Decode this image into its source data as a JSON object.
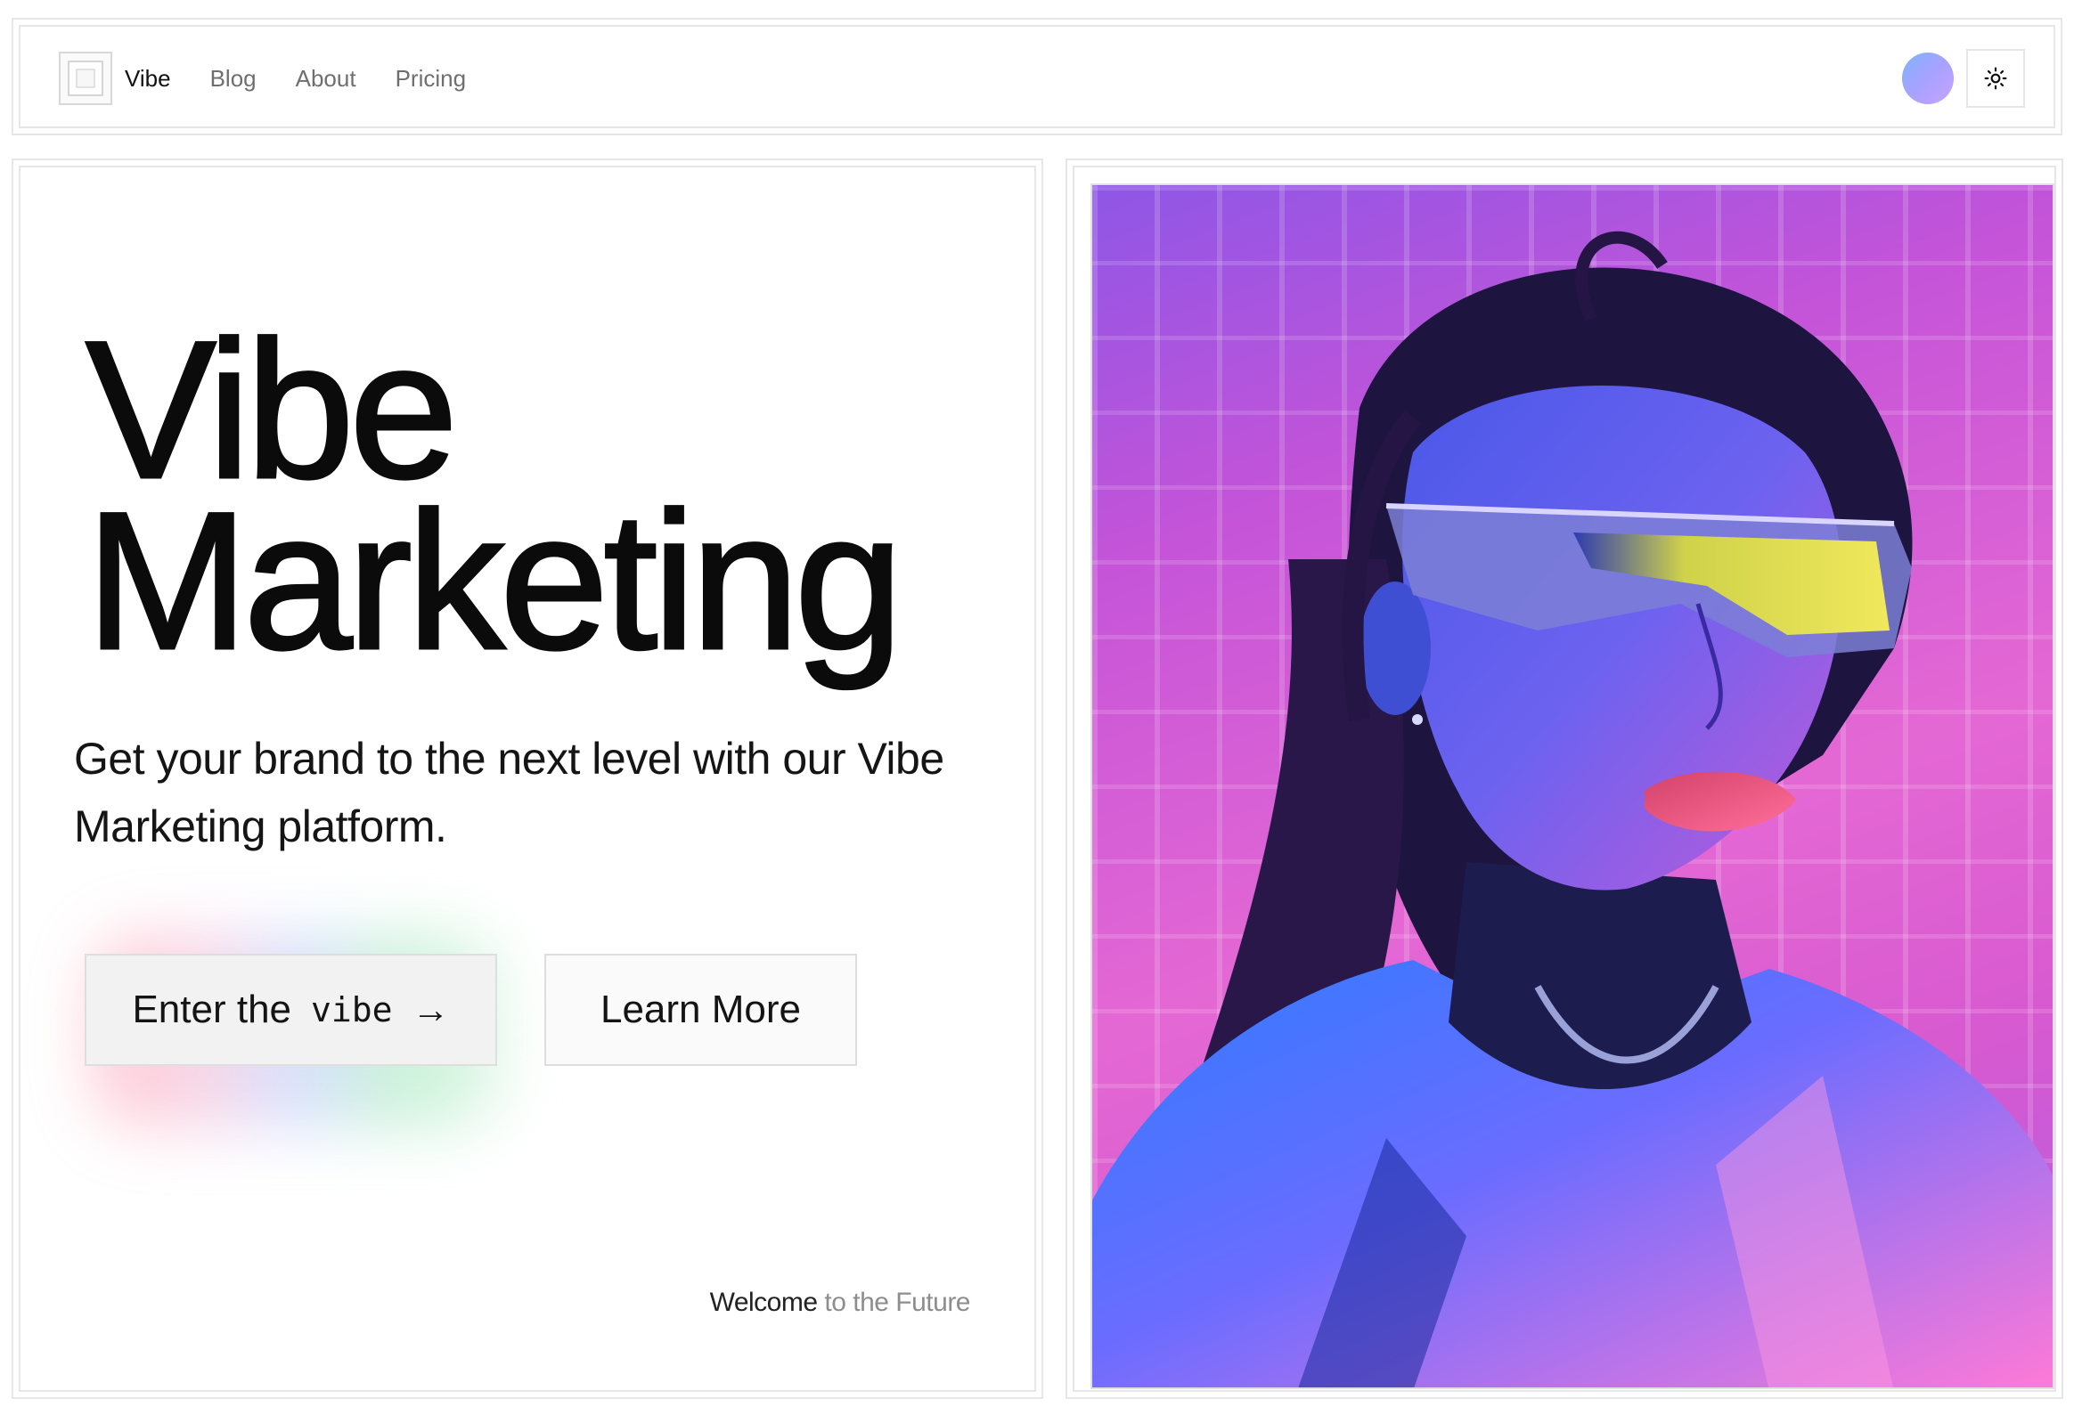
{
  "nav": {
    "brand_label": "Vibe",
    "links": [
      {
        "label": "Blog"
      },
      {
        "label": "About"
      },
      {
        "label": "Pricing"
      }
    ],
    "theme_toggle_icon": "sun-icon"
  },
  "hero": {
    "title_line1": "Vibe",
    "title_line2": "Marketing",
    "subtitle": "Get your brand to the next level with our Vibe Marketing platform.",
    "primary_button": {
      "label_prefix": "Enter the",
      "label_accent": "vibe",
      "icon": "arrow-right-icon"
    },
    "secondary_button": {
      "label": "Learn More"
    },
    "footer_tagline": {
      "strong": "Welcome",
      "muted": "to the Future"
    }
  },
  "colors": {
    "accent_gradient": [
      "#ff9fb2",
      "#b8c8ff",
      "#9fe8b8"
    ],
    "avatar_gradient": [
      "#7fb2ff",
      "#c7a3ff"
    ],
    "photo_background": "#e468d4"
  }
}
